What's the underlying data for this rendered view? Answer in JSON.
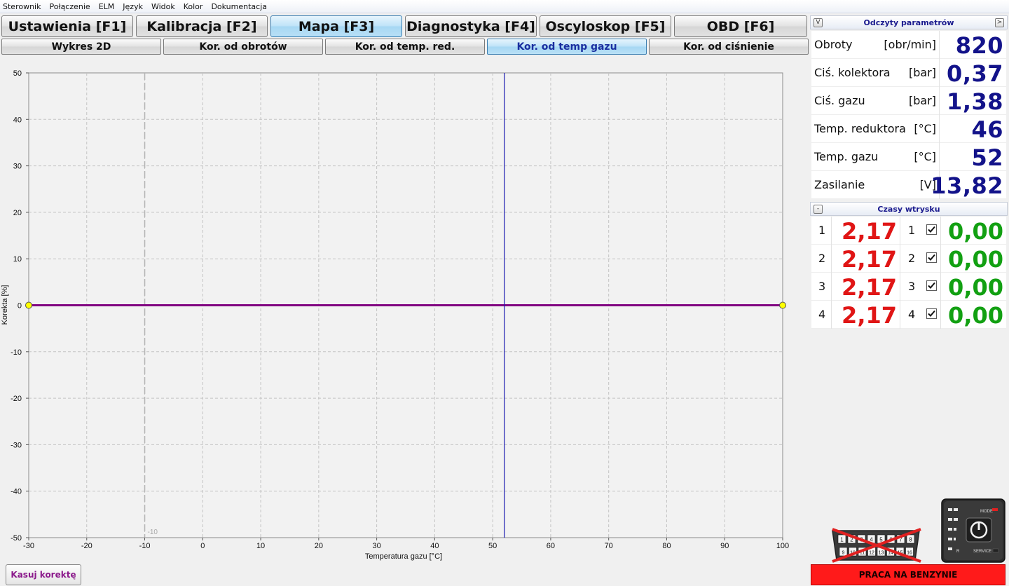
{
  "menu": [
    "Sterownik",
    "Połączenie",
    "ELM",
    "Język",
    "Widok",
    "Kolor",
    "Dokumentacja"
  ],
  "main_tabs": [
    {
      "label": "Ustawienia [F1]",
      "active": false
    },
    {
      "label": "Kalibracja [F2]",
      "active": false
    },
    {
      "label": "Mapa [F3]",
      "active": true
    },
    {
      "label": "Diagnostyka [F4]",
      "active": false
    },
    {
      "label": "Oscyloskop [F5]",
      "active": false
    },
    {
      "label": "OBD [F6]",
      "active": false
    }
  ],
  "sub_tabs": [
    {
      "label": "Wykres 2D",
      "active": false
    },
    {
      "label": "Kor. od obrotów",
      "active": false
    },
    {
      "label": "Kor. od temp. red.",
      "active": false
    },
    {
      "label": "Kor. od temp gazu",
      "active": true
    },
    {
      "label": "Kor. od ciśnienie",
      "active": false
    }
  ],
  "chart_data": {
    "type": "line",
    "xlabel": "Temperatura gazu [°C]",
    "ylabel": "Korekta [%]",
    "xlim": [
      -30,
      100
    ],
    "ylim": [
      -50,
      50
    ],
    "xticks": [
      -30,
      -20,
      -10,
      0,
      10,
      20,
      30,
      40,
      50,
      60,
      70,
      80,
      90,
      100
    ],
    "yticks": [
      50,
      40,
      30,
      20,
      10,
      0,
      -10,
      -20,
      -30,
      -40,
      -50
    ],
    "grid": true,
    "series": [
      {
        "x": [
          -30,
          100
        ],
        "y": [
          0,
          0
        ],
        "color": "#800080",
        "marker_color": "#ffff00"
      }
    ],
    "current_value_line": {
      "x": 52,
      "color": "#1a1ab0"
    },
    "reference_line": {
      "x": -10,
      "label": "-10"
    }
  },
  "reset_button": "Kasuj korektę",
  "params_panel": {
    "title": "Odczyty parametrów",
    "left_btn": "V",
    "right_btn": ">",
    "rows": [
      {
        "name": "Obroty",
        "unit": "[obr/min]",
        "value": "820"
      },
      {
        "name": "Ciś. kolektora",
        "unit": "[bar]",
        "value": "0,37"
      },
      {
        "name": "Ciś. gazu",
        "unit": "[bar]",
        "value": "1,38"
      },
      {
        "name": "Temp. reduktora",
        "unit": "[°C]",
        "value": "46"
      },
      {
        "name": "Temp. gazu",
        "unit": "[°C]",
        "value": "52"
      },
      {
        "name": "Zasilanie",
        "unit": "[V]",
        "value": "13,82"
      }
    ]
  },
  "injection_panel": {
    "title": "Czasy wtrysku",
    "collapse_btn": "-",
    "rows": [
      {
        "cyl": "1",
        "petrol": "2,17",
        "gas_cyl": "1",
        "checked": true,
        "gas": "0,00"
      },
      {
        "cyl": "2",
        "petrol": "2,17",
        "gas_cyl": "2",
        "checked": true,
        "gas": "0,00"
      },
      {
        "cyl": "3",
        "petrol": "2,17",
        "gas_cyl": "3",
        "checked": true,
        "gas": "0,00"
      },
      {
        "cyl": "4",
        "petrol": "2,17",
        "gas_cyl": "4",
        "checked": true,
        "gas": "0,00"
      }
    ]
  },
  "obd_icon": {
    "pins_top": [
      "1",
      "2",
      "3",
      "4",
      "5",
      "6",
      "7",
      "8"
    ],
    "pins_bottom": [
      "9",
      "10",
      "11",
      "12",
      "13",
      "14",
      "15",
      "16"
    ]
  },
  "device": {
    "mode_label": "MODE",
    "service_label": "SERVICE",
    "r_label": "R"
  },
  "status": "PRACA NA BENZYNIE",
  "colors": {
    "petrol": "#e01515",
    "gas": "#12a012",
    "param": "#13138a",
    "status_bg": "#ff1a1a",
    "series": "#800080"
  }
}
